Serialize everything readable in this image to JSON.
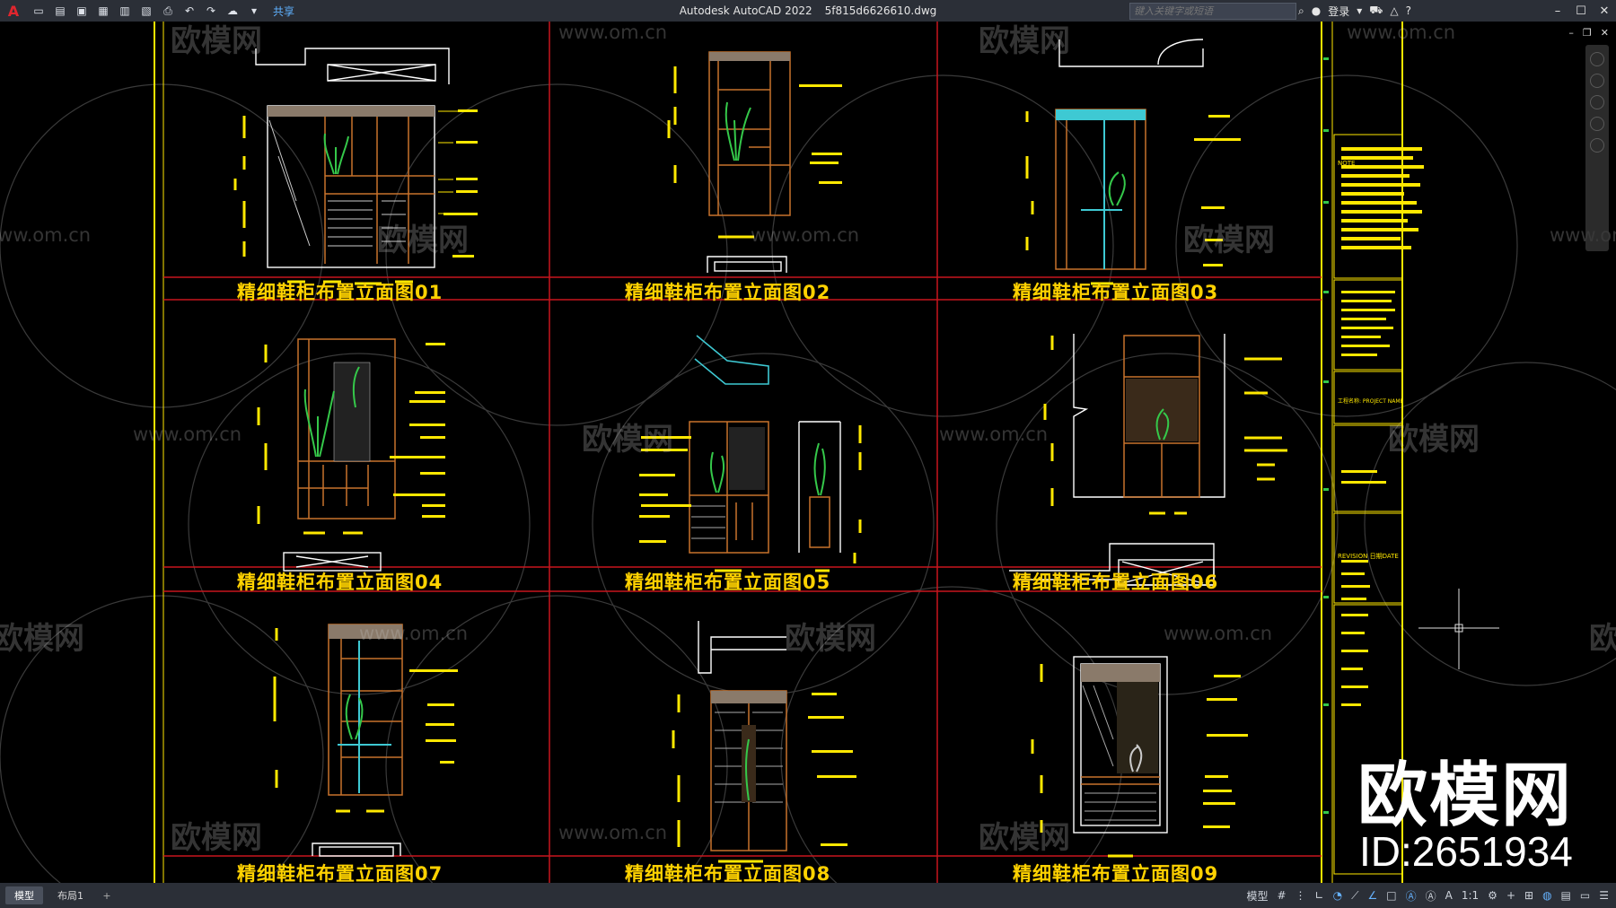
{
  "app": {
    "title": "Autodesk AutoCAD 2022",
    "filename": "5f815d6626610.dwg",
    "logo": "A"
  },
  "toolbar": {
    "share_label": "共享",
    "search_placeholder": "键入关键字或短语",
    "login_label": "登录"
  },
  "drawing": {
    "labels": [
      "精细鞋柜布置立面图01",
      "精细鞋柜布置立面图02",
      "精细鞋柜布置立面图03",
      "精细鞋柜布置立面图04",
      "精细鞋柜布置立面图05",
      "精细鞋柜布置立面图06",
      "精细鞋柜布置立面图07",
      "精细鞋柜布置立面图08",
      "精细鞋柜布置立面图09"
    ],
    "title_block": {
      "note": "NOTE",
      "project_name": "工程名称:\nPROJECT NAME",
      "revision": "REVISION  日期DATE"
    }
  },
  "watermark": {
    "brand": "欧模网",
    "url": "www.om.cn",
    "id": "ID:2651934"
  },
  "statusbar": {
    "tabs": [
      "模型",
      "布局1"
    ],
    "model_label": "模型",
    "scale": "1:1"
  },
  "colors": {
    "label": "#ffd200",
    "grid_red": "#c8161d",
    "frame_yellow": "#ffe800",
    "wood": "#c8722c",
    "plant": "#35c84a",
    "cyan": "#3ec9d3"
  }
}
